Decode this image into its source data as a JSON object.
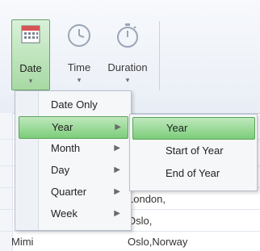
{
  "ribbon": {
    "buttons": [
      {
        "label": "Date",
        "icon": "calendar-icon",
        "selected": true
      },
      {
        "label": "Time",
        "icon": "clock-icon"
      },
      {
        "label": "Duration",
        "icon": "stopwatch-icon"
      }
    ]
  },
  "menu": {
    "items": [
      {
        "label": "Date Only",
        "has_submenu": false
      },
      {
        "label": "Year",
        "has_submenu": true,
        "selected": true
      },
      {
        "label": "Month",
        "has_submenu": true
      },
      {
        "label": "Day",
        "has_submenu": true
      },
      {
        "label": "Quarter",
        "has_submenu": true
      },
      {
        "label": "Week",
        "has_submenu": true
      }
    ]
  },
  "submenu": {
    "items": [
      {
        "label": "Year",
        "selected": true
      },
      {
        "label": "Start of Year"
      },
      {
        "label": "End of Year"
      }
    ]
  },
  "grid": {
    "rows": [
      {
        "col2": "London,"
      },
      {
        "col2": "Oslo,"
      },
      {
        "col1": "Mimi",
        "col2": "Oslo,Norway"
      }
    ]
  },
  "colors": {
    "selection_green": "#7ccd7a",
    "ribbon_bg": "#e9eef6"
  }
}
